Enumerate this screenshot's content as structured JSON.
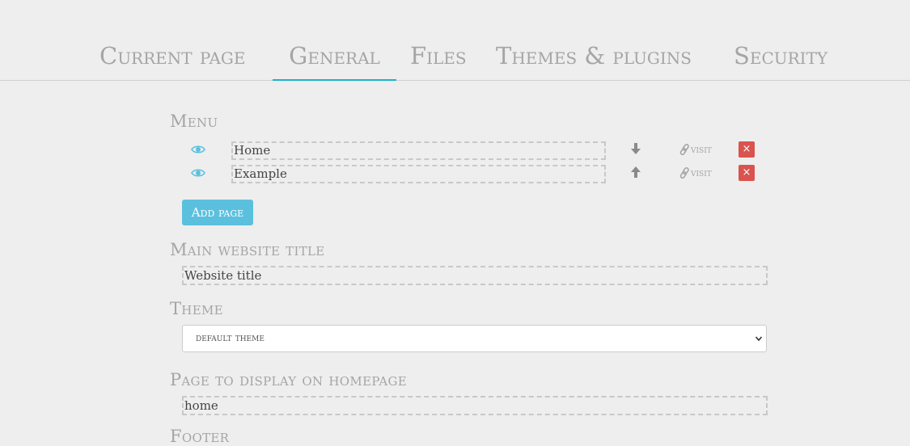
{
  "tabs": [
    {
      "label": "Current page"
    },
    {
      "label": "General"
    },
    {
      "label": "Files"
    },
    {
      "label": "Themes & plugins"
    },
    {
      "label": "Security"
    }
  ],
  "active_tab": "General",
  "menu": {
    "title": "Menu",
    "items": [
      {
        "value": "Home",
        "visit_label": "visit",
        "move_icon": "arrow-down-icon"
      },
      {
        "value": "Example",
        "visit_label": "visit",
        "move_icon": "arrow-up-icon"
      }
    ],
    "delete_label": "×",
    "add_label": "Add page"
  },
  "website_title": {
    "title": "Main website title",
    "value": "Website title"
  },
  "theme": {
    "title": "Theme",
    "selected": "default theme"
  },
  "homepage": {
    "title": "Page to display on homepage",
    "value": "home"
  },
  "footer": {
    "title": "Footer"
  },
  "colors": {
    "accent": "#1ab3c9",
    "button": "#5bc0de",
    "danger": "#d9534f",
    "eye": "#5bc0de",
    "muted": "#a5a5a5"
  }
}
